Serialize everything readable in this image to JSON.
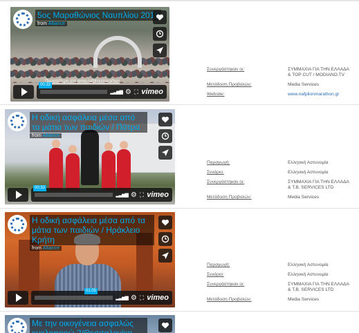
{
  "videos": [
    {
      "title": "5ος Μαραθώνιος Ναυπλίου 2018",
      "from_prefix": "from",
      "from_channel": "Alliance",
      "timecode": "00:33",
      "overlay_link": "Περισσότερα στο www.nafplionmarathon",
      "brand": "vimeo",
      "meta": [
        {
          "label": "Συνεργάστηκαν οι:",
          "value": "ΣΥΜΜΑΧΙΑ ΓΙΑ ΤΗΝ ΕΛΛΑΔΑ & TOP CUT / MODIANO.TV"
        },
        {
          "label": "Μετάδοση Προβολών:",
          "value": "Media Services"
        },
        {
          "label": "Website:",
          "value": "www.nafplionmarathon.gr",
          "is_link": true
        }
      ]
    },
    {
      "title": "Η οδική ασφάλεια μέσα από τα μάτια των παιδιών / Πάτρα",
      "from_prefix": "from",
      "from_channel": "Alliance",
      "timecode": "00:33",
      "brand": "vimeo",
      "meta": [
        {
          "label": "Παραγωγή:",
          "value": "Ελληνική Αστυνομία"
        },
        {
          "label": "Σενάριο:",
          "value": "Ελληνική Αστυνομία"
        },
        {
          "label": "Συνεργάστηκαν οι:",
          "value": "ΣΥΜΜΑΧΙΑ ΓΙΑ ΤΗΝ ΕΛΛΑΔΑ & T.B. SERVICES LTD"
        },
        {
          "label": "Μετάδοση Προβολών:",
          "value": "Media Services"
        }
      ]
    },
    {
      "title": "Η οδική ασφάλεια μέσα από τα μάτια των παιδιών / Ηράκλειο Κρήτη",
      "from_prefix": "from",
      "from_channel": "Alliance",
      "timecode": "01:05",
      "brand": "vimeo",
      "meta": [
        {
          "label": "Παραγωγή:",
          "value": "Ελληνική Αστυνομία"
        },
        {
          "label": "Σενάριο:",
          "value": "Ελληνική Αστυνομία"
        },
        {
          "label": "Συνεργάστηκαν οι:",
          "value": "ΣΥΜΜΑΧΙΑ ΓΙΑ ΤΗΝ ΕΛΛΑΔΑ & T.B. SERVICES LTD"
        },
        {
          "label": "Μετάδοση Προβολών:",
          "value": "Media Services"
        }
      ]
    },
    {
      "title": "Με την οικογένεια ασφαλώς κυκλοφορώ 2/Θεσσαλονίκη"
    }
  ],
  "icons": {
    "like": "heart-icon",
    "watch_later": "clock-icon",
    "share": "paper-plane-icon",
    "play": "play-icon",
    "settings": "gear-icon",
    "fullscreen": "fullscreen-icon"
  },
  "colors": {
    "accent": "#00adef",
    "link": "#2a6ebb"
  }
}
